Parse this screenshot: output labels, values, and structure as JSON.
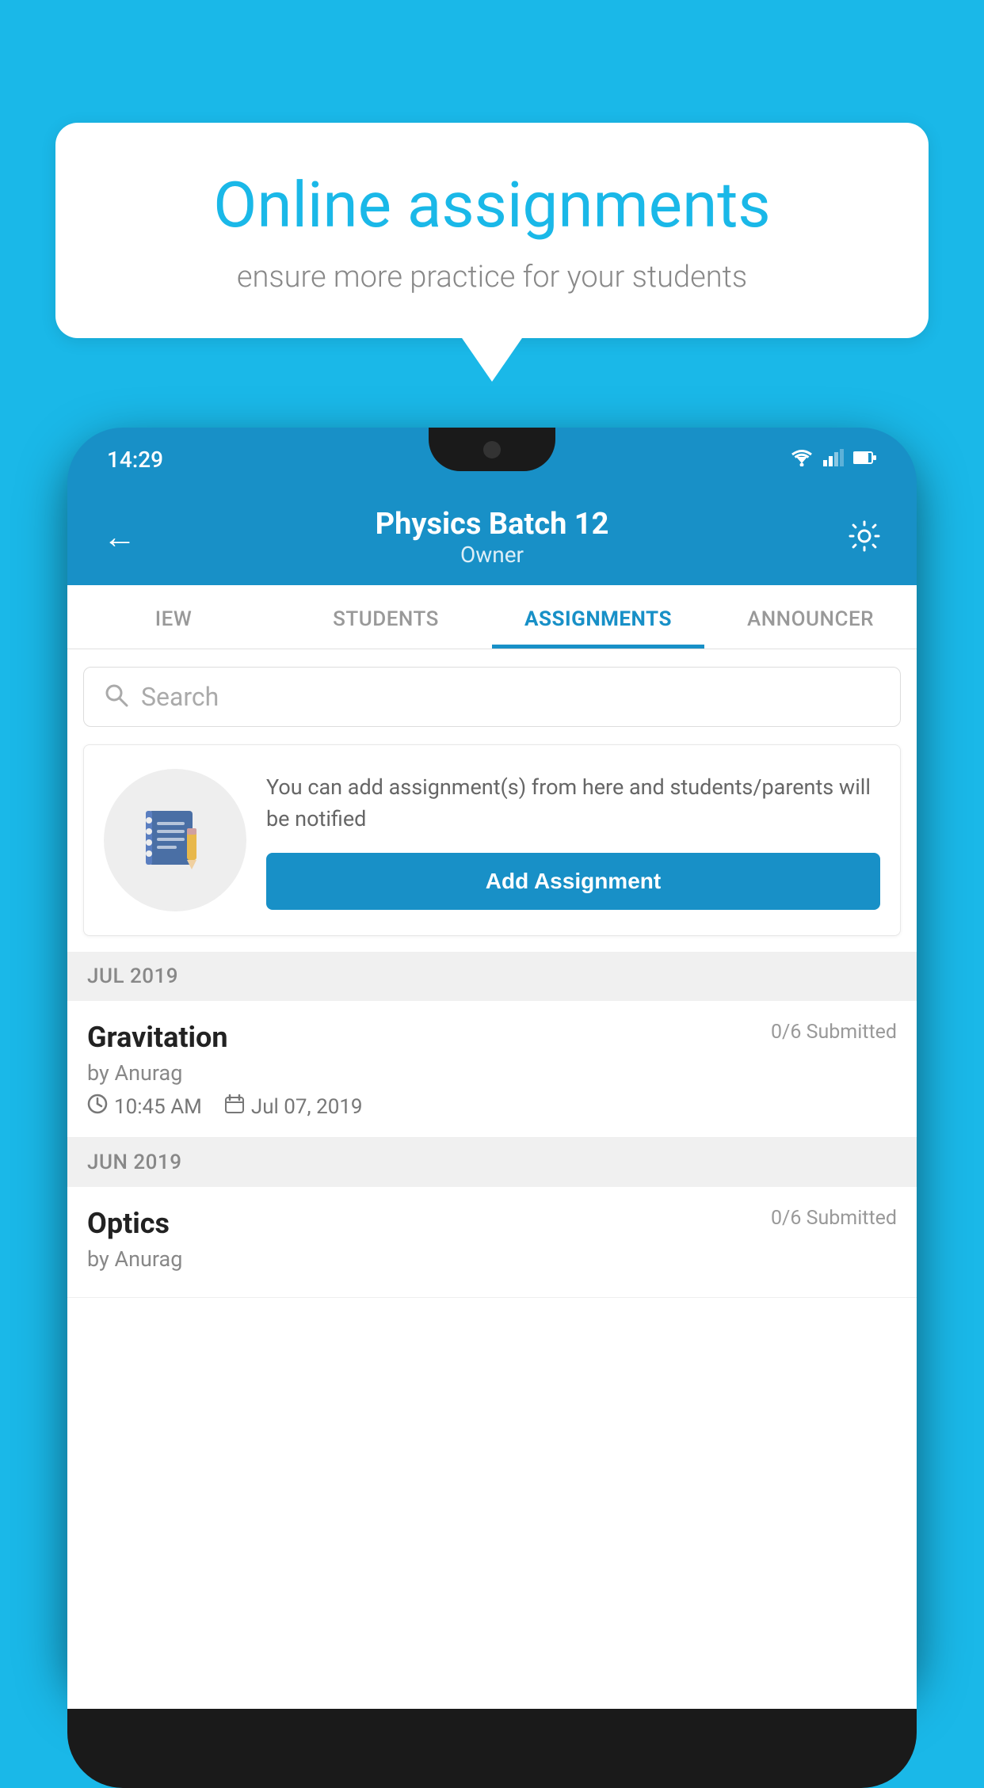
{
  "background": {
    "color": "#1ab8e8"
  },
  "speech_bubble": {
    "title": "Online assignments",
    "subtitle": "ensure more practice for your students"
  },
  "phone": {
    "status_bar": {
      "time": "14:29",
      "wifi_icon": "▼",
      "signal_icon": "▲",
      "battery_icon": "▮"
    },
    "header": {
      "back_label": "←",
      "title": "Physics Batch 12",
      "subtitle": "Owner",
      "settings_label": "⚙"
    },
    "tabs": [
      {
        "label": "IEW",
        "active": false
      },
      {
        "label": "STUDENTS",
        "active": false
      },
      {
        "label": "ASSIGNMENTS",
        "active": true
      },
      {
        "label": "ANNOUNCER",
        "active": false
      }
    ],
    "search": {
      "placeholder": "Search"
    },
    "empty_state": {
      "description": "You can add assignment(s) from here and students/parents will be notified",
      "button_label": "Add Assignment"
    },
    "sections": [
      {
        "header": "JUL 2019",
        "assignments": [
          {
            "name": "Gravitation",
            "submitted": "0/6 Submitted",
            "by": "by Anurag",
            "time": "10:45 AM",
            "date": "Jul 07, 2019"
          }
        ]
      },
      {
        "header": "JUN 2019",
        "assignments": [
          {
            "name": "Optics",
            "submitted": "0/6 Submitted",
            "by": "by Anurag",
            "time": "",
            "date": ""
          }
        ]
      }
    ]
  }
}
